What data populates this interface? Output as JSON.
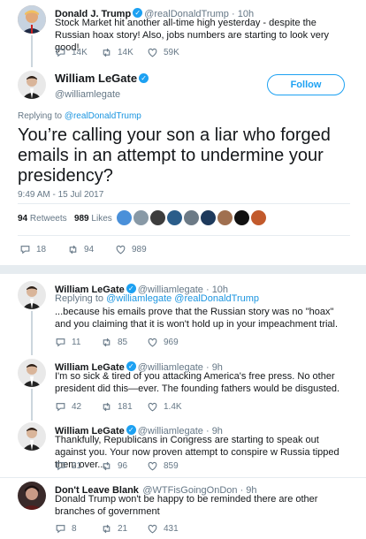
{
  "parent": {
    "name": "Donald J. Trump",
    "handle": "@realDonaldTrump",
    "time": "10h",
    "text": "Stock Market hit another all-time high yesterday - despite the Russian hoax story! Also, jobs numbers are starting to look very good!",
    "replies": "14K",
    "retweets": "14K",
    "likes": "59K"
  },
  "main": {
    "name": "William LeGate",
    "handle": "@williamlegate",
    "follow_label": "Follow",
    "replying_prefix": "Replying to",
    "replying_to": "@realDonaldTrump",
    "text": "You’re calling your son a liar who forged emails in an attempt to undermine your presidency?",
    "timestamp": "9:49 AM - 15 Jul 2017",
    "retweets_count": "94",
    "retweets_label": "Retweets",
    "likes_count": "989",
    "likes_label": "Likes",
    "replies": "18",
    "retweets": "94",
    "likes": "989"
  },
  "replies": [
    {
      "name": "William LeGate",
      "handle": "@williamlegate",
      "time": "10h",
      "replying_prefix": "Replying to",
      "replying_to": "@williamlegate @realDonaldTrump",
      "text": "...because his emails prove that the Russian story was no \"hoax\" and you claiming that it is won't hold up in your impeachment trial.",
      "replies": "11",
      "retweets": "85",
      "likes": "969"
    },
    {
      "name": "William LeGate",
      "handle": "@williamlegate",
      "time": "9h",
      "text": "I'm so sick & tired of you attacking America's free press. No other president did this—ever. The founding fathers would be disgusted.",
      "replies": "42",
      "retweets": "181",
      "likes": "1.4K"
    },
    {
      "name": "William LeGate",
      "handle": "@williamlegate",
      "time": "9h",
      "text": "Thankfully, Republicans in Congress are starting to speak out against you. Your now proven attempt to conspire w Russia tipped them over...",
      "replies": "21",
      "retweets": "96",
      "likes": "859"
    },
    {
      "name": "Don't Leave Blank",
      "handle": "@WTFisGoingOnDon",
      "time": "9h",
      "text": "Donald Trump won't be happy to be reminded there are other branches of government",
      "replies": "8",
      "retweets": "21",
      "likes": "431"
    }
  ],
  "colors": {
    "accent": "#1da1f2",
    "text": "#14171a",
    "muted": "#657786",
    "divider": "#e6ecf0"
  }
}
